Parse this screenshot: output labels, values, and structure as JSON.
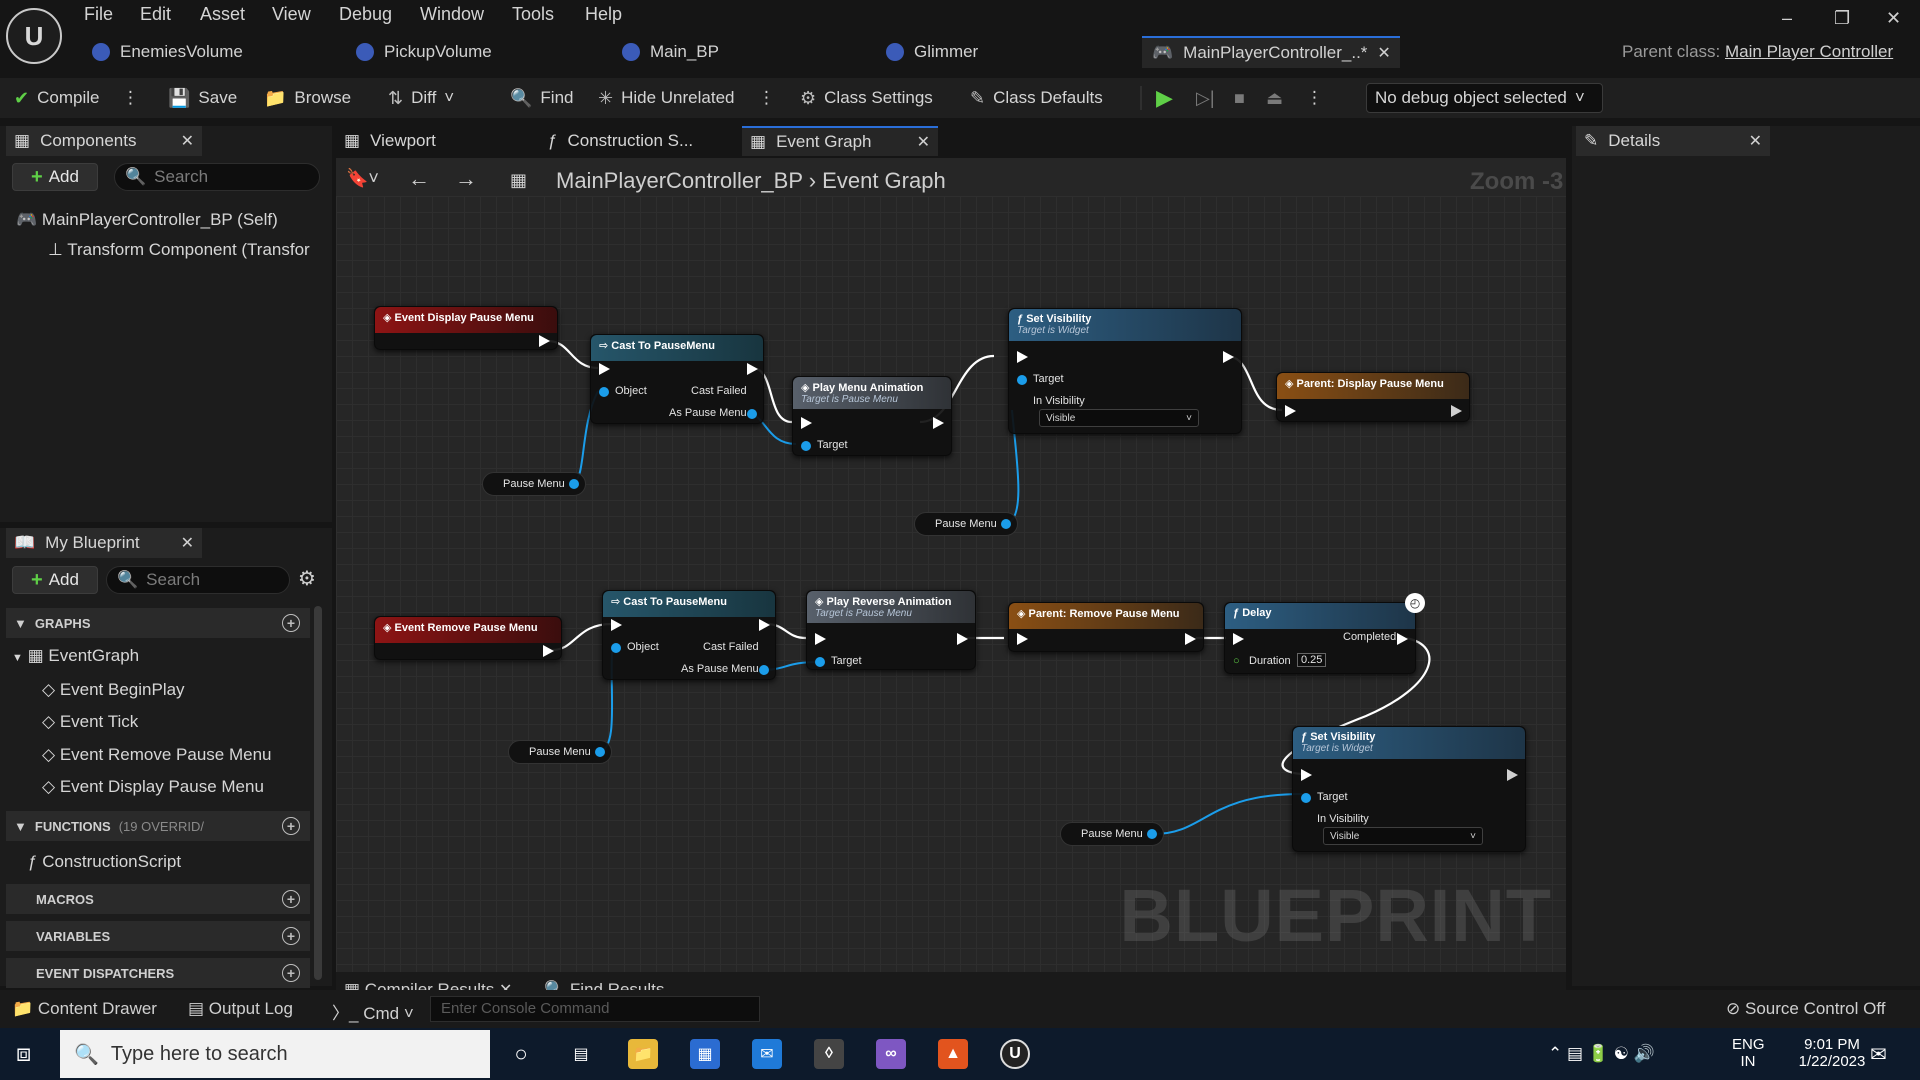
{
  "menu": [
    "File",
    "Edit",
    "Asset",
    "View",
    "Debug",
    "Window",
    "Tools",
    "Help"
  ],
  "doc_tabs": [
    "EnemiesVolume",
    "PickupVolume",
    "Main_BP",
    "Glimmer",
    "MainPlayerController_..*"
  ],
  "parent_class": {
    "label": "Parent class:",
    "value": "Main Player Controller"
  },
  "toolbar": {
    "compile": "Compile",
    "save": "Save",
    "browse": "Browse",
    "diff": "Diff",
    "find": "Find",
    "hide_unrelated": "Hide Unrelated",
    "class_settings": "Class Settings",
    "class_defaults": "Class Defaults",
    "debug_object": "No debug object selected"
  },
  "components": {
    "tab": "Components",
    "add": "Add",
    "search_placeholder": "Search",
    "items": [
      "MainPlayerController_BP (Self)",
      "Transform Component (Transfor"
    ]
  },
  "graph_tabs": [
    "Viewport",
    "Construction S...",
    "Event Graph"
  ],
  "breadcrumb": {
    "root": "MainPlayerController_BP",
    "current": "Event Graph",
    "zoom": "Zoom -3"
  },
  "details": {
    "tab": "Details"
  },
  "my_blueprint": {
    "tab": "My Blueprint",
    "add": "Add",
    "search_placeholder": "Search",
    "graphs_header": "GRAPHS",
    "event_graph": "EventGraph",
    "events": [
      "Event BeginPlay",
      "Event Tick",
      "Event Remove Pause Menu",
      "Event Display Pause Menu"
    ],
    "functions_header": "FUNCTIONS",
    "functions_count": "(19 OVERRID/",
    "functions": [
      "ConstructionScript"
    ],
    "macros_header": "MACROS",
    "variables_header": "VARIABLES",
    "dispatchers_header": "EVENT DISPATCHERS"
  },
  "nodes": {
    "event_display": "Event Display Pause Menu",
    "cast1": "Cast To PauseMenu",
    "object": "Object",
    "cast_failed": "Cast Failed",
    "as_pause_menu": "As Pause Menu",
    "play_anim": "Play Menu Animation",
    "target_pause_menu": "Target is Pause Menu",
    "target": "Target",
    "set_vis": "Set Visibility",
    "target_widget": "Target is Widget",
    "in_visibility": "In Visibility",
    "visible": "Visible",
    "parent_display": "Parent: Display Pause Menu",
    "pause_menu": "Pause Menu",
    "event_remove": "Event Remove Pause Menu",
    "play_reverse": "Play Reverse Animation",
    "parent_remove": "Parent: Remove Pause Menu",
    "delay": "Delay",
    "completed": "Completed",
    "duration": "Duration",
    "duration_value": "0.25",
    "watermark": "BLUEPRINT"
  },
  "bottom": {
    "compiler_results": "Compiler Results",
    "find_results": "Find Results",
    "content_drawer": "Content Drawer",
    "output_log": "Output Log",
    "cmd": "Cmd",
    "console_placeholder": "Enter Console Command",
    "source_control": "Source Control Off"
  },
  "taskbar": {
    "search_placeholder": "Type here to search",
    "lang1": "ENG",
    "lang2": "IN",
    "time": "9:01 PM",
    "date": "1/22/2023"
  },
  "colors": {
    "exec": "#ffffff",
    "object_pin": "#1b9dea",
    "event_header": "#8e1414",
    "accent": "#2a6ed8"
  }
}
